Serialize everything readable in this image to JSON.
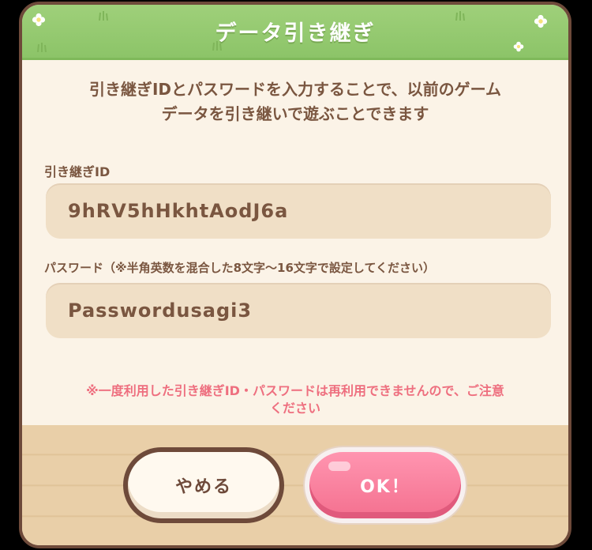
{
  "dialog": {
    "title": "データ引き継ぎ",
    "intro_line1": "引き継ぎIDとパスワードを入力することで、以前のゲーム",
    "intro_line2": "データを引き継いで遊ぶことできます",
    "id_label": "引き継ぎID",
    "id_value": "9hRV5hHkhtAodJ6a",
    "password_label": "パスワード（※半角英数を混合した8文字～16文字で設定してください）",
    "password_value": "Passwordusagi3",
    "notice_line1": "※一度利用した引き継ぎID・パスワードは再利用できませんので、ご注意",
    "notice_line2": "ください",
    "cancel_label": "やめる",
    "ok_label": "OK！"
  },
  "colors": {
    "header_green": "#8cc468",
    "text_brown": "#7a5640",
    "notice_pink": "#ee6f7f",
    "ok_pink": "#f4708f",
    "field_beige": "#f0dfc6"
  }
}
